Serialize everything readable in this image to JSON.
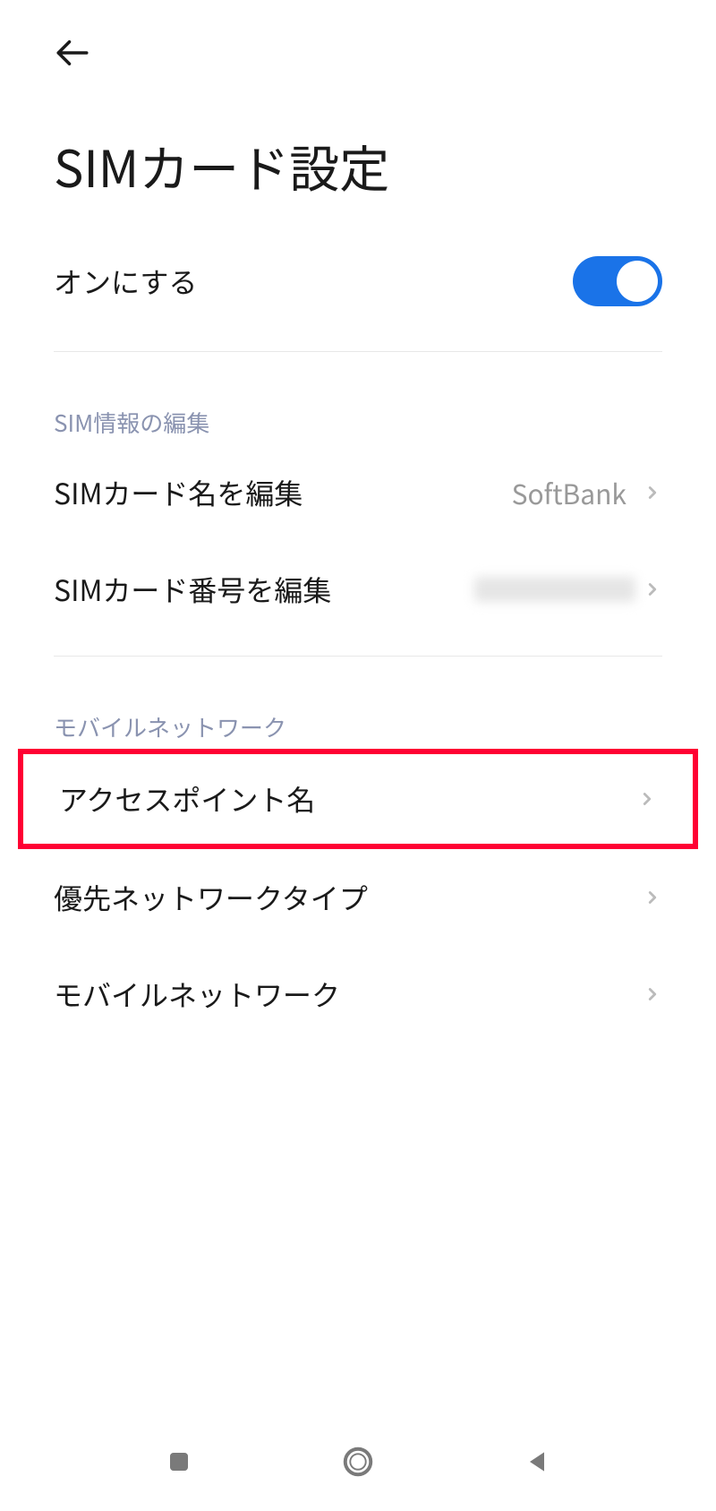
{
  "header": {
    "title": "SIMカード設定"
  },
  "enable": {
    "label": "オンにする",
    "on": true
  },
  "sections": {
    "sim_info": {
      "header": "SIM情報の編集",
      "edit_name": {
        "label": "SIMカード名を編集",
        "value": "SoftBank"
      },
      "edit_number": {
        "label": "SIMカード番号を編集"
      }
    },
    "mobile_network": {
      "header": "モバイルネットワーク",
      "apn": {
        "label": "アクセスポイント名"
      },
      "preferred_type": {
        "label": "優先ネットワークタイプ"
      },
      "mobile_network": {
        "label": "モバイルネットワーク"
      }
    }
  }
}
